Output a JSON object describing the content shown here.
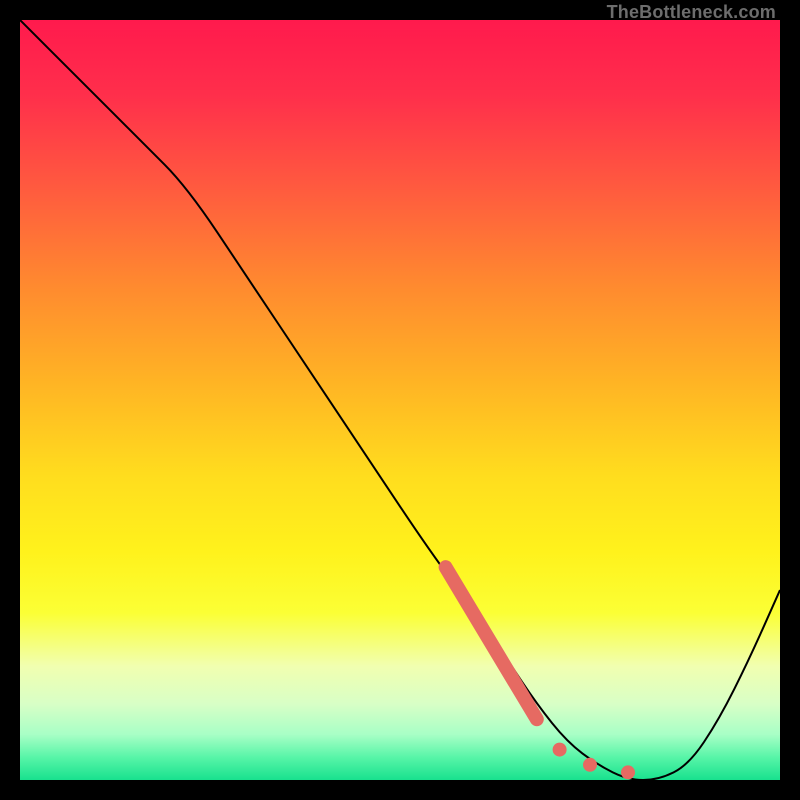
{
  "watermark": "TheBottleneck.com",
  "colors": {
    "accent": "#e66a62",
    "curve": "#000000",
    "frame_bg": "#000000"
  },
  "chart_data": {
    "type": "line",
    "title": "",
    "xlabel": "",
    "ylabel": "",
    "xlim": [
      0,
      100
    ],
    "ylim": [
      0,
      100
    ],
    "grid": false,
    "legend": false,
    "series": [
      {
        "name": "bottleneck-curve",
        "x": [
          0,
          8,
          16,
          22,
          30,
          38,
          46,
          54,
          60,
          64,
          68,
          72,
          76,
          80,
          84,
          88,
          92,
          96,
          100
        ],
        "y": [
          100,
          92,
          84,
          78,
          66,
          54,
          42,
          30,
          22,
          16,
          10,
          5,
          2,
          0,
          0,
          2,
          8,
          16,
          25
        ]
      }
    ],
    "accent_segment": {
      "name": "highlight-steep",
      "x": [
        56,
        68
      ],
      "y": [
        28,
        8
      ]
    },
    "accent_dots": {
      "name": "highlight-minimum",
      "points": [
        {
          "x": 71,
          "y": 4
        },
        {
          "x": 75,
          "y": 2
        },
        {
          "x": 80,
          "y": 1
        }
      ]
    }
  }
}
